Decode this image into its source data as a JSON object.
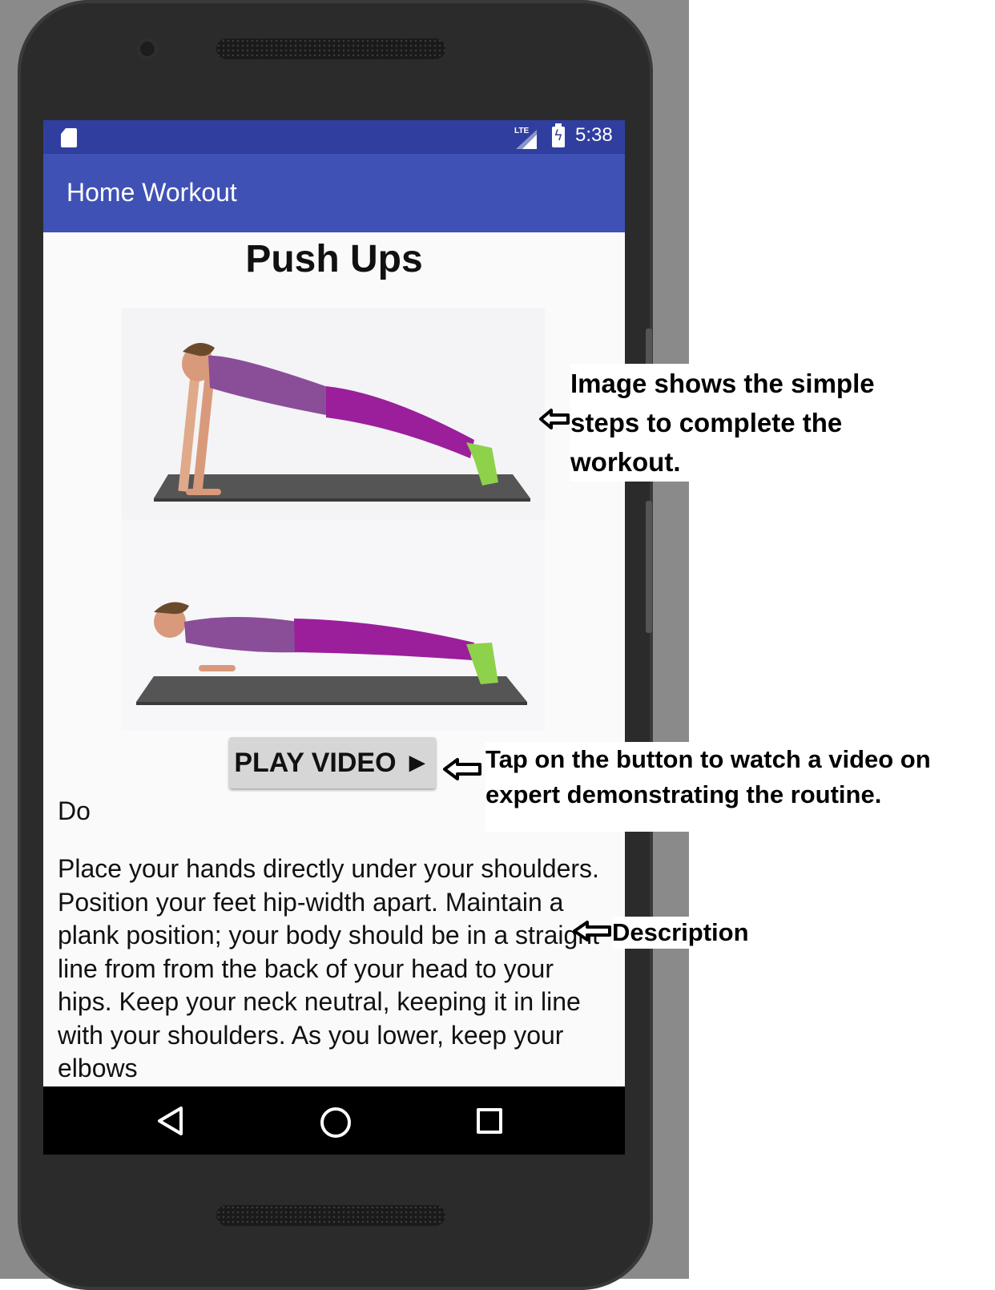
{
  "status_bar": {
    "network": "LTE",
    "time": "5:38"
  },
  "app_bar": {
    "title": "Home Workout"
  },
  "exercise": {
    "title": "Push Ups",
    "play_button_label": "PLAY VIDEO ►",
    "description_heading": "Do",
    "description": "Place your hands directly under your shoulders. Position your feet hip-width apart. Maintain a plank position; your body should be in a straight line from from the back of your head to your hips. Keep your neck neutral, keeping it in line with your shoulders. As you lower, keep your elbows"
  },
  "annotations": {
    "image": "Image shows the simple steps to complete the workout.",
    "button": "Tap on the button to watch a video on expert demonstrating the routine.",
    "description": "Description"
  },
  "nav_bar": {
    "back": "back-icon",
    "home": "home-icon",
    "recent": "recent-apps-icon"
  },
  "colors": {
    "status_bar": "#303f9f",
    "app_bar": "#3f51b5",
    "accent": "#9c27b0"
  }
}
